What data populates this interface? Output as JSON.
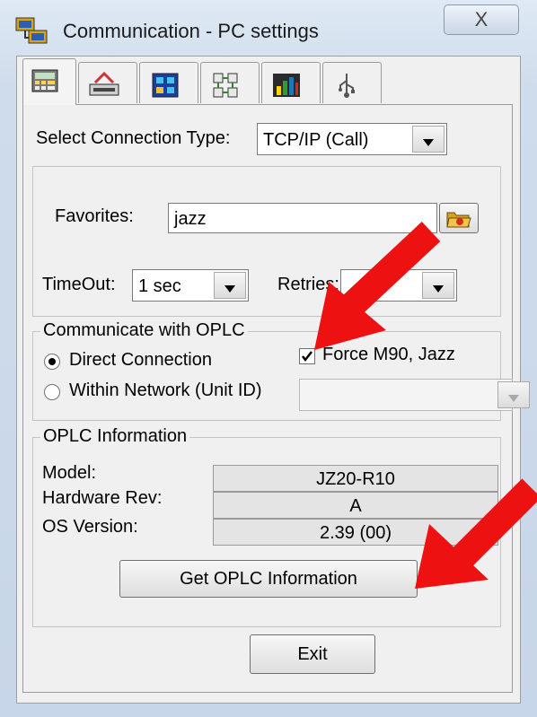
{
  "window": {
    "title": "Communication - PC settings",
    "close_glyph": "X"
  },
  "tabs": [
    {
      "icon": "calculator-icon",
      "active": true
    },
    {
      "icon": "device-io-icon"
    },
    {
      "icon": "network-icon"
    },
    {
      "icon": "grid-connect-icon"
    },
    {
      "icon": "chart-icon"
    },
    {
      "icon": "usb-icon"
    }
  ],
  "connection": {
    "label": "Select Connection Type:",
    "value": "TCP/IP (Call)"
  },
  "favorites": {
    "label": "Favorites:",
    "value": "jazz"
  },
  "timeout": {
    "label": "TimeOut:",
    "value": "1 sec"
  },
  "retries": {
    "label": "Retries:",
    "value": ""
  },
  "communicate": {
    "title": "Communicate with OPLC",
    "direct_label": "Direct Connection",
    "network_label": "Within Network (Unit ID)",
    "force_label": "Force M90, Jazz",
    "force_checked": true,
    "selected": "direct"
  },
  "info": {
    "title": "OPLC Information",
    "model_label": "Model:",
    "model_value": "JZ20-R10",
    "hw_label": "Hardware Rev:",
    "hw_value": "A",
    "os_label": "OS Version:",
    "os_value": "2.39 (00)"
  },
  "buttons": {
    "get_info": "Get OPLC Information",
    "exit": "Exit"
  },
  "colors": {
    "arrow": "#ee1111",
    "titlebar": "#c7d6e8"
  }
}
